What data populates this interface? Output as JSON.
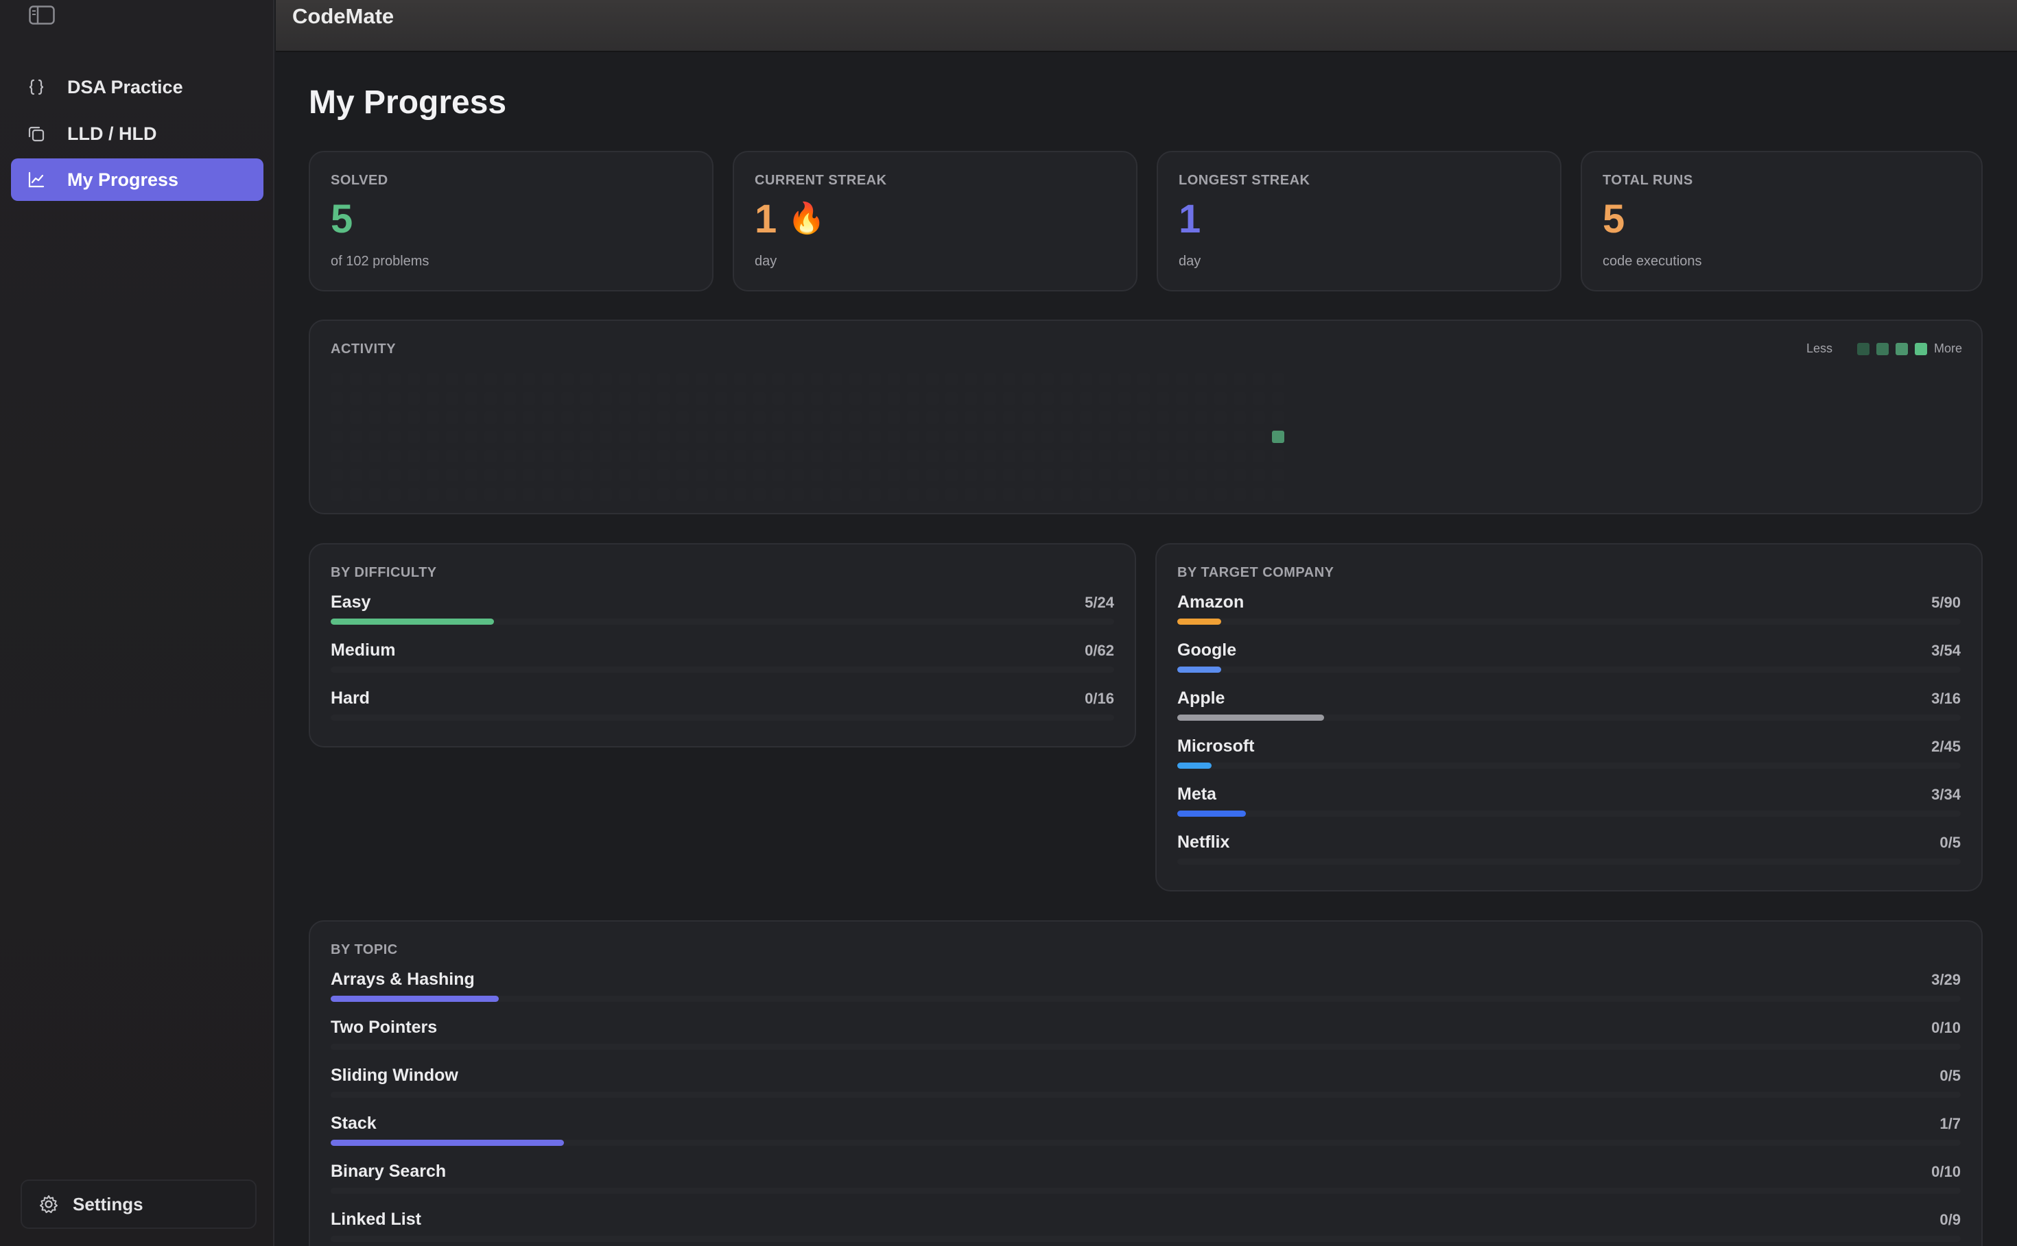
{
  "app": {
    "title": "CodeMate"
  },
  "sidebar": {
    "items": [
      {
        "label": "DSA Practice",
        "icon": "braces-icon",
        "active": false
      },
      {
        "label": "LLD / HLD",
        "icon": "copy-icon",
        "active": false
      },
      {
        "label": "My Progress",
        "icon": "chart-line-icon",
        "active": true
      }
    ],
    "settings_label": "Settings"
  },
  "page": {
    "title": "My Progress"
  },
  "stats": [
    {
      "label": "SOLVED",
      "value": "5",
      "sub": "of 102 problems",
      "color": "#5bbf85"
    },
    {
      "label": "CURRENT STREAK",
      "value": "1",
      "emoji": "🔥",
      "sub": "day",
      "color": "#f0a35a"
    },
    {
      "label": "LONGEST STREAK",
      "value": "1",
      "sub": "day",
      "color": "#6f72e8"
    },
    {
      "label": "TOTAL RUNS",
      "value": "5",
      "sub": "code executions",
      "color": "#f0a35a"
    }
  ],
  "activity": {
    "label": "ACTIVITY",
    "legend_less": "Less",
    "legend_more": "More",
    "legend_colors": [
      "#2f5a45",
      "#3c7658",
      "#4c946d",
      "#5bbf85"
    ],
    "active_cells": [
      {
        "week": 49,
        "day": 3,
        "color": "#4c946d"
      }
    ]
  },
  "difficulty": {
    "label": "BY DIFFICULTY",
    "rows": [
      {
        "name": "Easy",
        "count": "5/24",
        "progress": 0.208,
        "color": "#5bbf85"
      },
      {
        "name": "Medium",
        "count": "0/62",
        "progress": 0,
        "color": "#f0a35a"
      },
      {
        "name": "Hard",
        "count": "0/16",
        "progress": 0,
        "color": "#e2605a"
      }
    ]
  },
  "company": {
    "label": "BY TARGET COMPANY",
    "rows": [
      {
        "name": "Amazon",
        "count": "5/90",
        "progress": 0.056,
        "color": "#f0a035"
      },
      {
        "name": "Google",
        "count": "3/54",
        "progress": 0.056,
        "color": "#5b8def"
      },
      {
        "name": "Apple",
        "count": "3/16",
        "progress": 0.1875,
        "color": "#9a9aa0"
      },
      {
        "name": "Microsoft",
        "count": "2/45",
        "progress": 0.044,
        "color": "#3aa0ef"
      },
      {
        "name": "Meta",
        "count": "3/34",
        "progress": 0.088,
        "color": "#3a6ef0"
      },
      {
        "name": "Netflix",
        "count": "0/5",
        "progress": 0,
        "color": "#e2605a"
      }
    ]
  },
  "topic": {
    "label": "BY TOPIC",
    "rows": [
      {
        "name": "Arrays & Hashing",
        "count": "3/29",
        "progress": 0.103,
        "color": "#6f6fe8"
      },
      {
        "name": "Two Pointers",
        "count": "0/10",
        "progress": 0,
        "color": "#6f6fe8"
      },
      {
        "name": "Sliding Window",
        "count": "0/5",
        "progress": 0,
        "color": "#6f6fe8"
      },
      {
        "name": "Stack",
        "count": "1/7",
        "progress": 0.143,
        "color": "#6f6fe8"
      },
      {
        "name": "Binary Search",
        "count": "0/10",
        "progress": 0,
        "color": "#6f6fe8"
      },
      {
        "name": "Linked List",
        "count": "0/9",
        "progress": 0,
        "color": "#6f6fe8"
      }
    ]
  }
}
